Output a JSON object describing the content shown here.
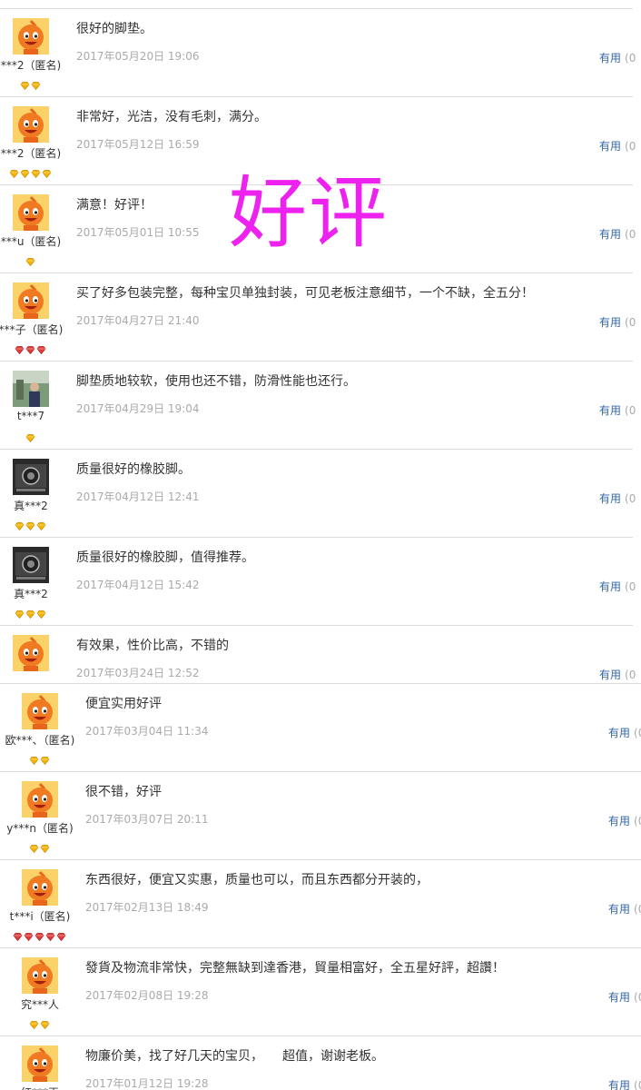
{
  "stamp_text": "好评",
  "colors": {
    "useful_link": "#3366aa",
    "stamp": "#ee22ee",
    "timestamp": "#aaaaaa"
  },
  "reviews": [
    {
      "user": "***2（匿名)",
      "content": "很好的脚垫。",
      "date": "2017年05月20日 19:06",
      "useful_label": "有用",
      "useful_count": "(0",
      "badges": [
        "gold",
        "gold"
      ],
      "avatar": "orange-mascot-icon"
    },
    {
      "user": "***2（匿名)",
      "content": "非常好，光洁，没有毛刺，满分。",
      "date": "2017年05月12日 16:59",
      "useful_label": "有用",
      "useful_count": "(0",
      "badges": [
        "gold",
        "gold",
        "gold",
        "gold"
      ],
      "avatar": "orange-mascot-icon"
    },
    {
      "user": "***u（匿名)",
      "content": "满意！好评！",
      "date": "2017年05月01日 10:55",
      "useful_label": "有用",
      "useful_count": "(0",
      "badges": [
        "gold"
      ],
      "avatar": "orange-mascot-icon"
    },
    {
      "user": "***子（匿名)",
      "content": "买了好多包装完整，每种宝贝单独封装，可见老板注意细节，一个不缺，全五分！",
      "date": "2017年04月27日 21:40",
      "useful_label": "有用",
      "useful_count": "(0",
      "badges": [
        "red",
        "red",
        "red"
      ],
      "avatar": "orange-mascot-icon"
    },
    {
      "user": "t***7",
      "content": "脚垫质地较软，使用也还不错，防滑性能也还行。",
      "date": "2017年04月29日 19:04",
      "useful_label": "有用",
      "useful_count": "(0",
      "badges": [
        "gold"
      ],
      "avatar": "person-photo-icon"
    },
    {
      "user": "真***2",
      "content": "质量很好的橡胶脚。",
      "date": "2017年04月12日 12:41",
      "useful_label": "有用",
      "useful_count": "(0",
      "badges": [
        "gold",
        "gold",
        "gold"
      ],
      "avatar": "device-photo-icon"
    },
    {
      "user": "真***2",
      "content": "质量很好的橡胶脚，值得推荐。",
      "date": "2017年04月12日 15:42",
      "useful_label": "有用",
      "useful_count": "(0",
      "badges": [
        "gold",
        "gold",
        "gold"
      ],
      "avatar": "device-photo-icon"
    },
    {
      "user": "",
      "content": "有效果，性价比高，不错的",
      "date": "2017年03月24日 12:52",
      "useful_label": "有用",
      "useful_count": "(0",
      "badges": [],
      "avatar": "orange-mascot-icon"
    },
    {
      "user": "欧***、（匿名)",
      "content": "便宜实用好评",
      "date": "2017年03月04日 11:34",
      "useful_label": "有用",
      "useful_count": "(0",
      "badges": [
        "gold",
        "gold"
      ],
      "avatar": "orange-mascot-icon"
    },
    {
      "user": "y***n（匿名)",
      "content": "很不错，好评",
      "date": "2017年03月07日 20:11",
      "useful_label": "有用",
      "useful_count": "(0",
      "badges": [
        "gold",
        "gold"
      ],
      "avatar": "orange-mascot-icon"
    },
    {
      "user": "t***i（匿名)",
      "content": "东西很好，便宜又实惠，质量也可以，而且东西都分开装的，",
      "date": "2017年02月13日 18:49",
      "useful_label": "有用",
      "useful_count": "(0",
      "badges": [
        "red",
        "red",
        "red",
        "red",
        "red"
      ],
      "avatar": "orange-mascot-icon"
    },
    {
      "user": "究***人",
      "content": "發貨及物流非常快，完整無缺到達香港，貿量相富好，全五星好評，超讚！",
      "date": "2017年02月08日 19:28",
      "useful_label": "有用",
      "useful_count": "(0",
      "badges": [
        "gold",
        "gold"
      ],
      "avatar": "orange-mascot-icon"
    },
    {
      "user": "红***王",
      "content": "物廉价美，找了好几天的宝贝，　　超值，谢谢老板。",
      "date": "2017年01月12日 19:28",
      "useful_label": "有用",
      "useful_count": "(0",
      "badges": [],
      "avatar": "orange-mascot-icon"
    }
  ]
}
